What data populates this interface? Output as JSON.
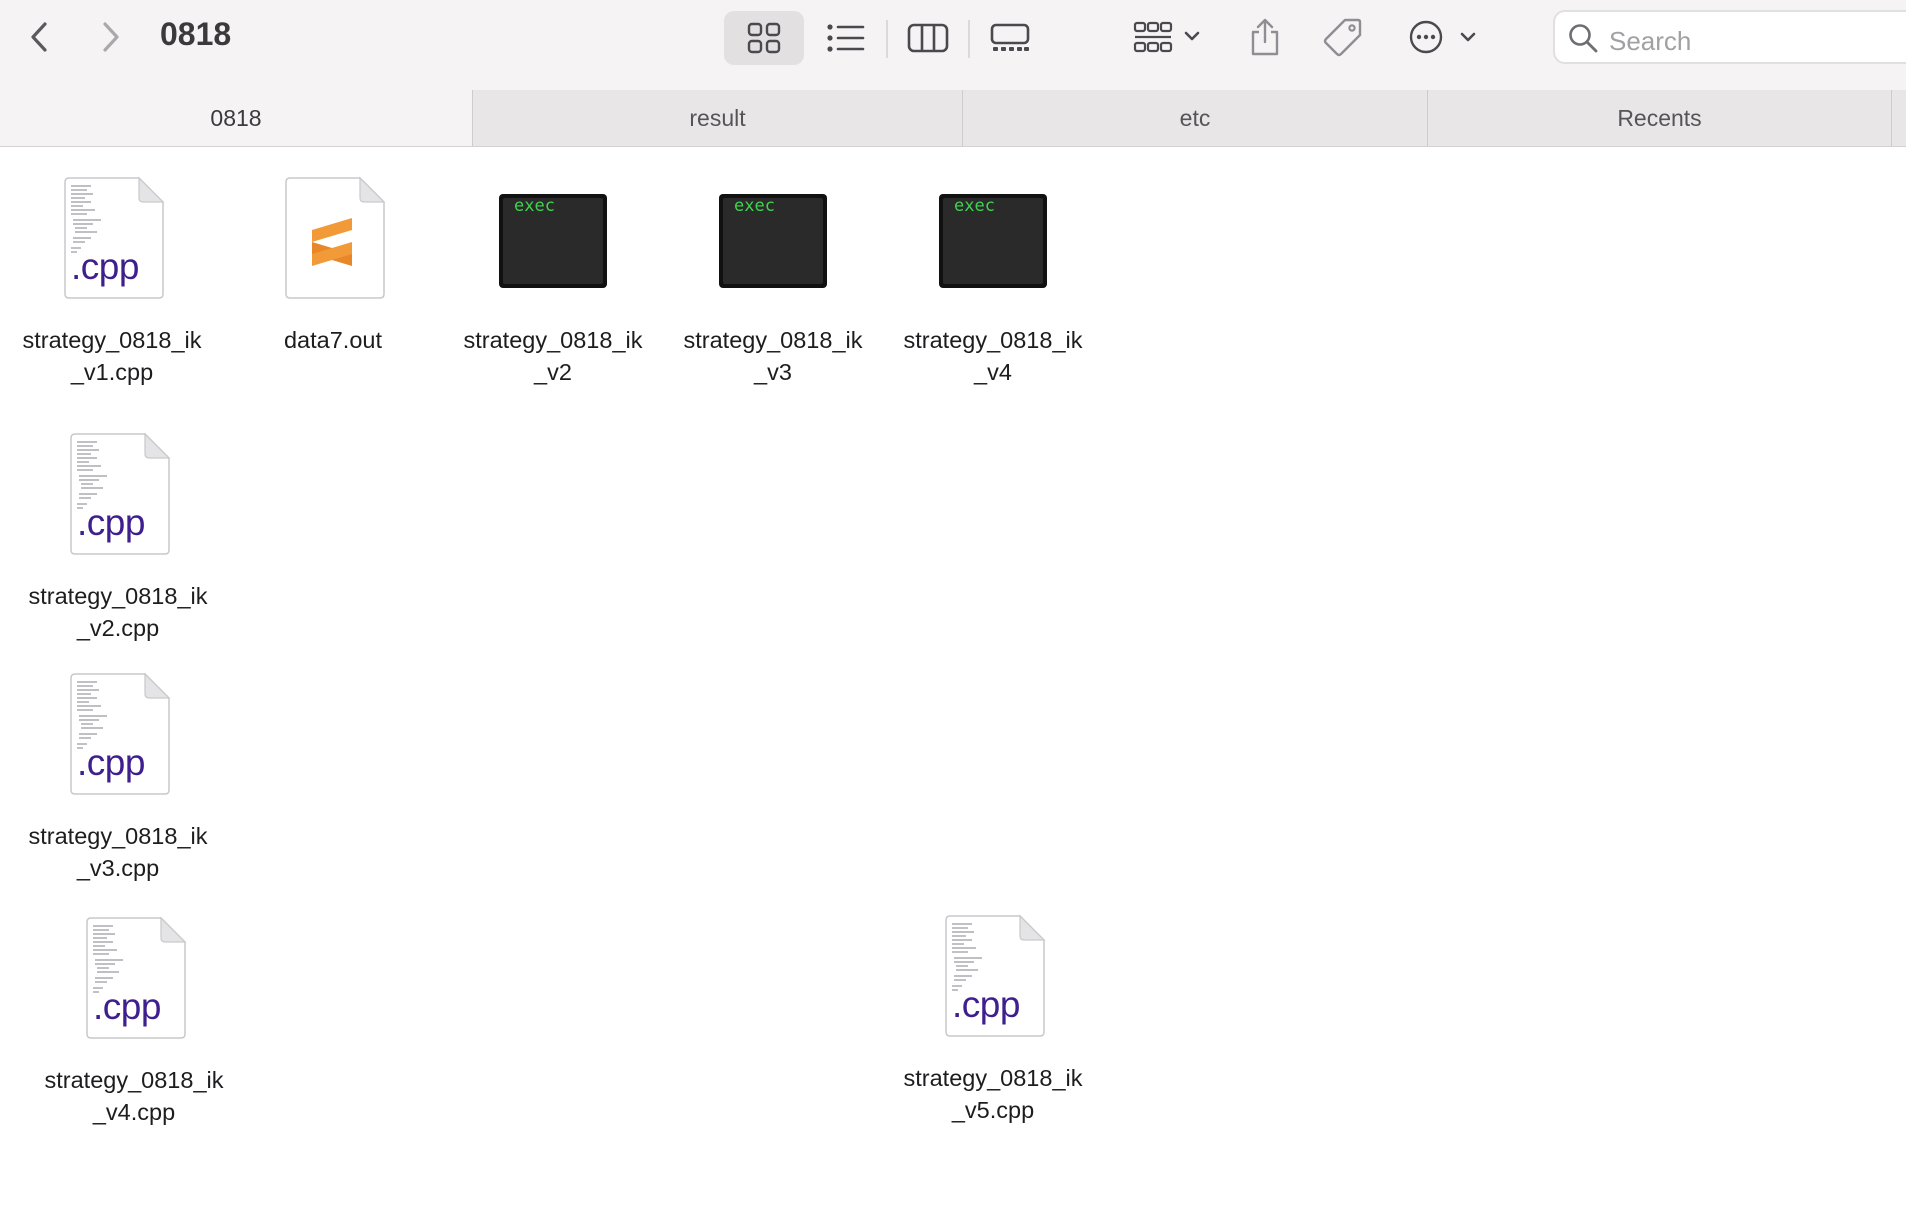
{
  "window": {
    "title": "0818"
  },
  "toolbar": {
    "back_icon": "chevron-left-icon",
    "forward_icon": "chevron-right-icon",
    "view_modes": [
      "icon-view",
      "list-view",
      "column-view",
      "gallery-view"
    ],
    "active_view": "icon-view",
    "group_icon": "group-by-icon",
    "share_icon": "share-icon",
    "tag_icon": "tag-icon",
    "more_icon": "ellipsis-circle-icon",
    "search": {
      "placeholder": "Search"
    }
  },
  "tabs": [
    {
      "label": "0818",
      "active": true
    },
    {
      "label": "result",
      "active": false
    },
    {
      "label": "etc",
      "active": false
    },
    {
      "label": "Recents",
      "active": false
    }
  ],
  "files": [
    {
      "name": "strategy_0818_ik_v1.cpp",
      "line1": "strategy_0818_ik",
      "line2": "_v1.cpp",
      "kind": "cpp",
      "icon_text": ".cpp"
    },
    {
      "name": "data7.out",
      "line1": "data7.out",
      "line2": "",
      "kind": "sublime"
    },
    {
      "name": "strategy_0818_ik_v2",
      "line1": "strategy_0818_ik",
      "line2": "_v2",
      "kind": "exec",
      "icon_text": "exec"
    },
    {
      "name": "strategy_0818_ik_v3",
      "line1": "strategy_0818_ik",
      "line2": "_v3",
      "kind": "exec",
      "icon_text": "exec"
    },
    {
      "name": "strategy_0818_ik_v4",
      "line1": "strategy_0818_ik",
      "line2": "_v4",
      "kind": "exec",
      "icon_text": "exec"
    },
    {
      "name": "strategy_0818_ik_v2.cpp",
      "line1": "strategy_0818_ik",
      "line2": "_v2.cpp",
      "kind": "cpp",
      "icon_text": ".cpp"
    },
    {
      "name": "strategy_0818_ik_v3.cpp",
      "line1": "strategy_0818_ik",
      "line2": "_v3.cpp",
      "kind": "cpp",
      "icon_text": ".cpp"
    },
    {
      "name": "strategy_0818_ik_v4.cpp",
      "line1": "strategy_0818_ik",
      "line2": "_v4.cpp",
      "kind": "cpp",
      "icon_text": ".cpp"
    },
    {
      "name": "strategy_0818_ik_v5.cpp",
      "line1": "strategy_0818_ik",
      "line2": "_v5.cpp",
      "kind": "cpp",
      "icon_text": ".cpp"
    }
  ],
  "colors": {
    "toolbar_bg": "#f6f3f5",
    "tab_bar_bg": "#e9e6e8",
    "cpp_label": "#3f1f8e",
    "exec_text": "#3fd24f",
    "sublime_orange": "#f29a38"
  }
}
